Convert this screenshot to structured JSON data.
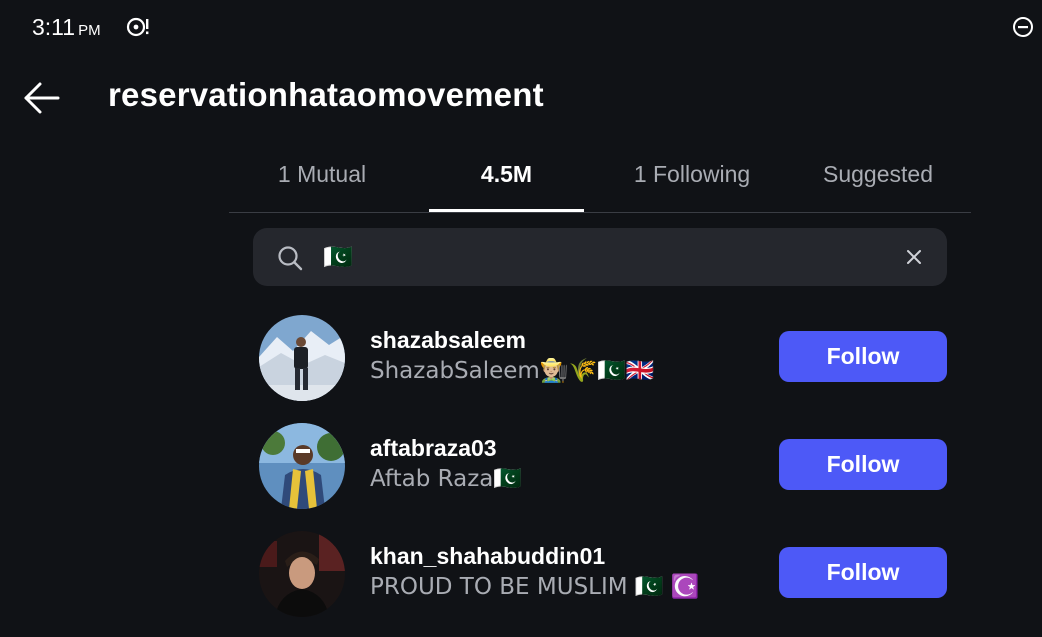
{
  "status_bar": {
    "time": "3:11",
    "ampm": "PM"
  },
  "header": {
    "title": "reservationhataomovement",
    "back_icon": "arrow-left-icon"
  },
  "tabs": [
    {
      "label": "1 Mutual",
      "active": false
    },
    {
      "label": "4.5M",
      "active": true
    },
    {
      "label": "1 Following",
      "active": false
    },
    {
      "label": "Suggested",
      "active": false
    }
  ],
  "search": {
    "value": "🇵🇰",
    "icon": "search-icon",
    "clear_icon": "close-icon"
  },
  "results": [
    {
      "username": "shazabsaleem",
      "full_name": "ShazabSaleem👨🏼‍🌾🌾🇵🇰🇬🇧",
      "button": "Follow"
    },
    {
      "username": "aftabraza03",
      "full_name": "Aftab Raza🇵🇰",
      "button": "Follow"
    },
    {
      "username": "khan_shahabuddin01",
      "full_name": "PROUD TO BE MUSLIM 🇵🇰 ☪️",
      "button": "Follow"
    }
  ],
  "colors": {
    "background": "#101216",
    "follow_button": "#4d59f7",
    "search_bg": "#25272d",
    "muted_text": "#a9acb3"
  }
}
